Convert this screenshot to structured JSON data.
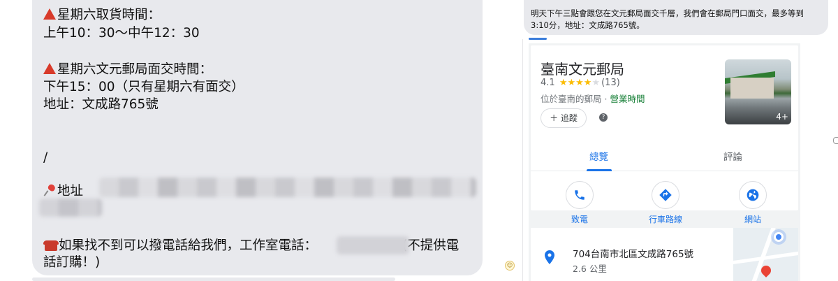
{
  "left_message": {
    "line1": "星期六取貨時間：",
    "line2": "上午10：30～中午12：30",
    "line3": "星期六文元郵局面交時間：",
    "line4": "下午15：00（只有星期六有面交）",
    "line5": "地址：文成路765號",
    "line6": "/",
    "address_label": "地址",
    "phone_prefix": "如果找不到可以撥電話給我們，工作室電話：",
    "phone_suffix": "(不提供電",
    "phone_line2": "話訂購！)"
  },
  "right_message": {
    "text": "明天下午三點會跟您在文元郵局面交千層，我們會在郵局門口面交，最多等到3:10分，地址：文成路765號。"
  },
  "place_card": {
    "name": "臺南文元郵局",
    "rating": "4.1",
    "stars_filled": 4,
    "stars_total": 5,
    "review_count": "(13)",
    "category": "位於臺南的郵局",
    "separator": "·",
    "hours_link": "營業時間",
    "follow_label": "追蹤",
    "follow_plus": "＋",
    "help": "?",
    "photo_count": "4+",
    "tabs": [
      "總覽",
      "評論"
    ],
    "actions": [
      "致電",
      "行車路線",
      "網站"
    ],
    "address": "704台南市北區文成路765號",
    "distance": "2.6 公里"
  },
  "colors": {
    "bubble": "#e8e9ed",
    "accent_blue": "#1a73e8",
    "green": "#188038",
    "star": "#fbbc04",
    "alert_red": "#d83a2a"
  }
}
